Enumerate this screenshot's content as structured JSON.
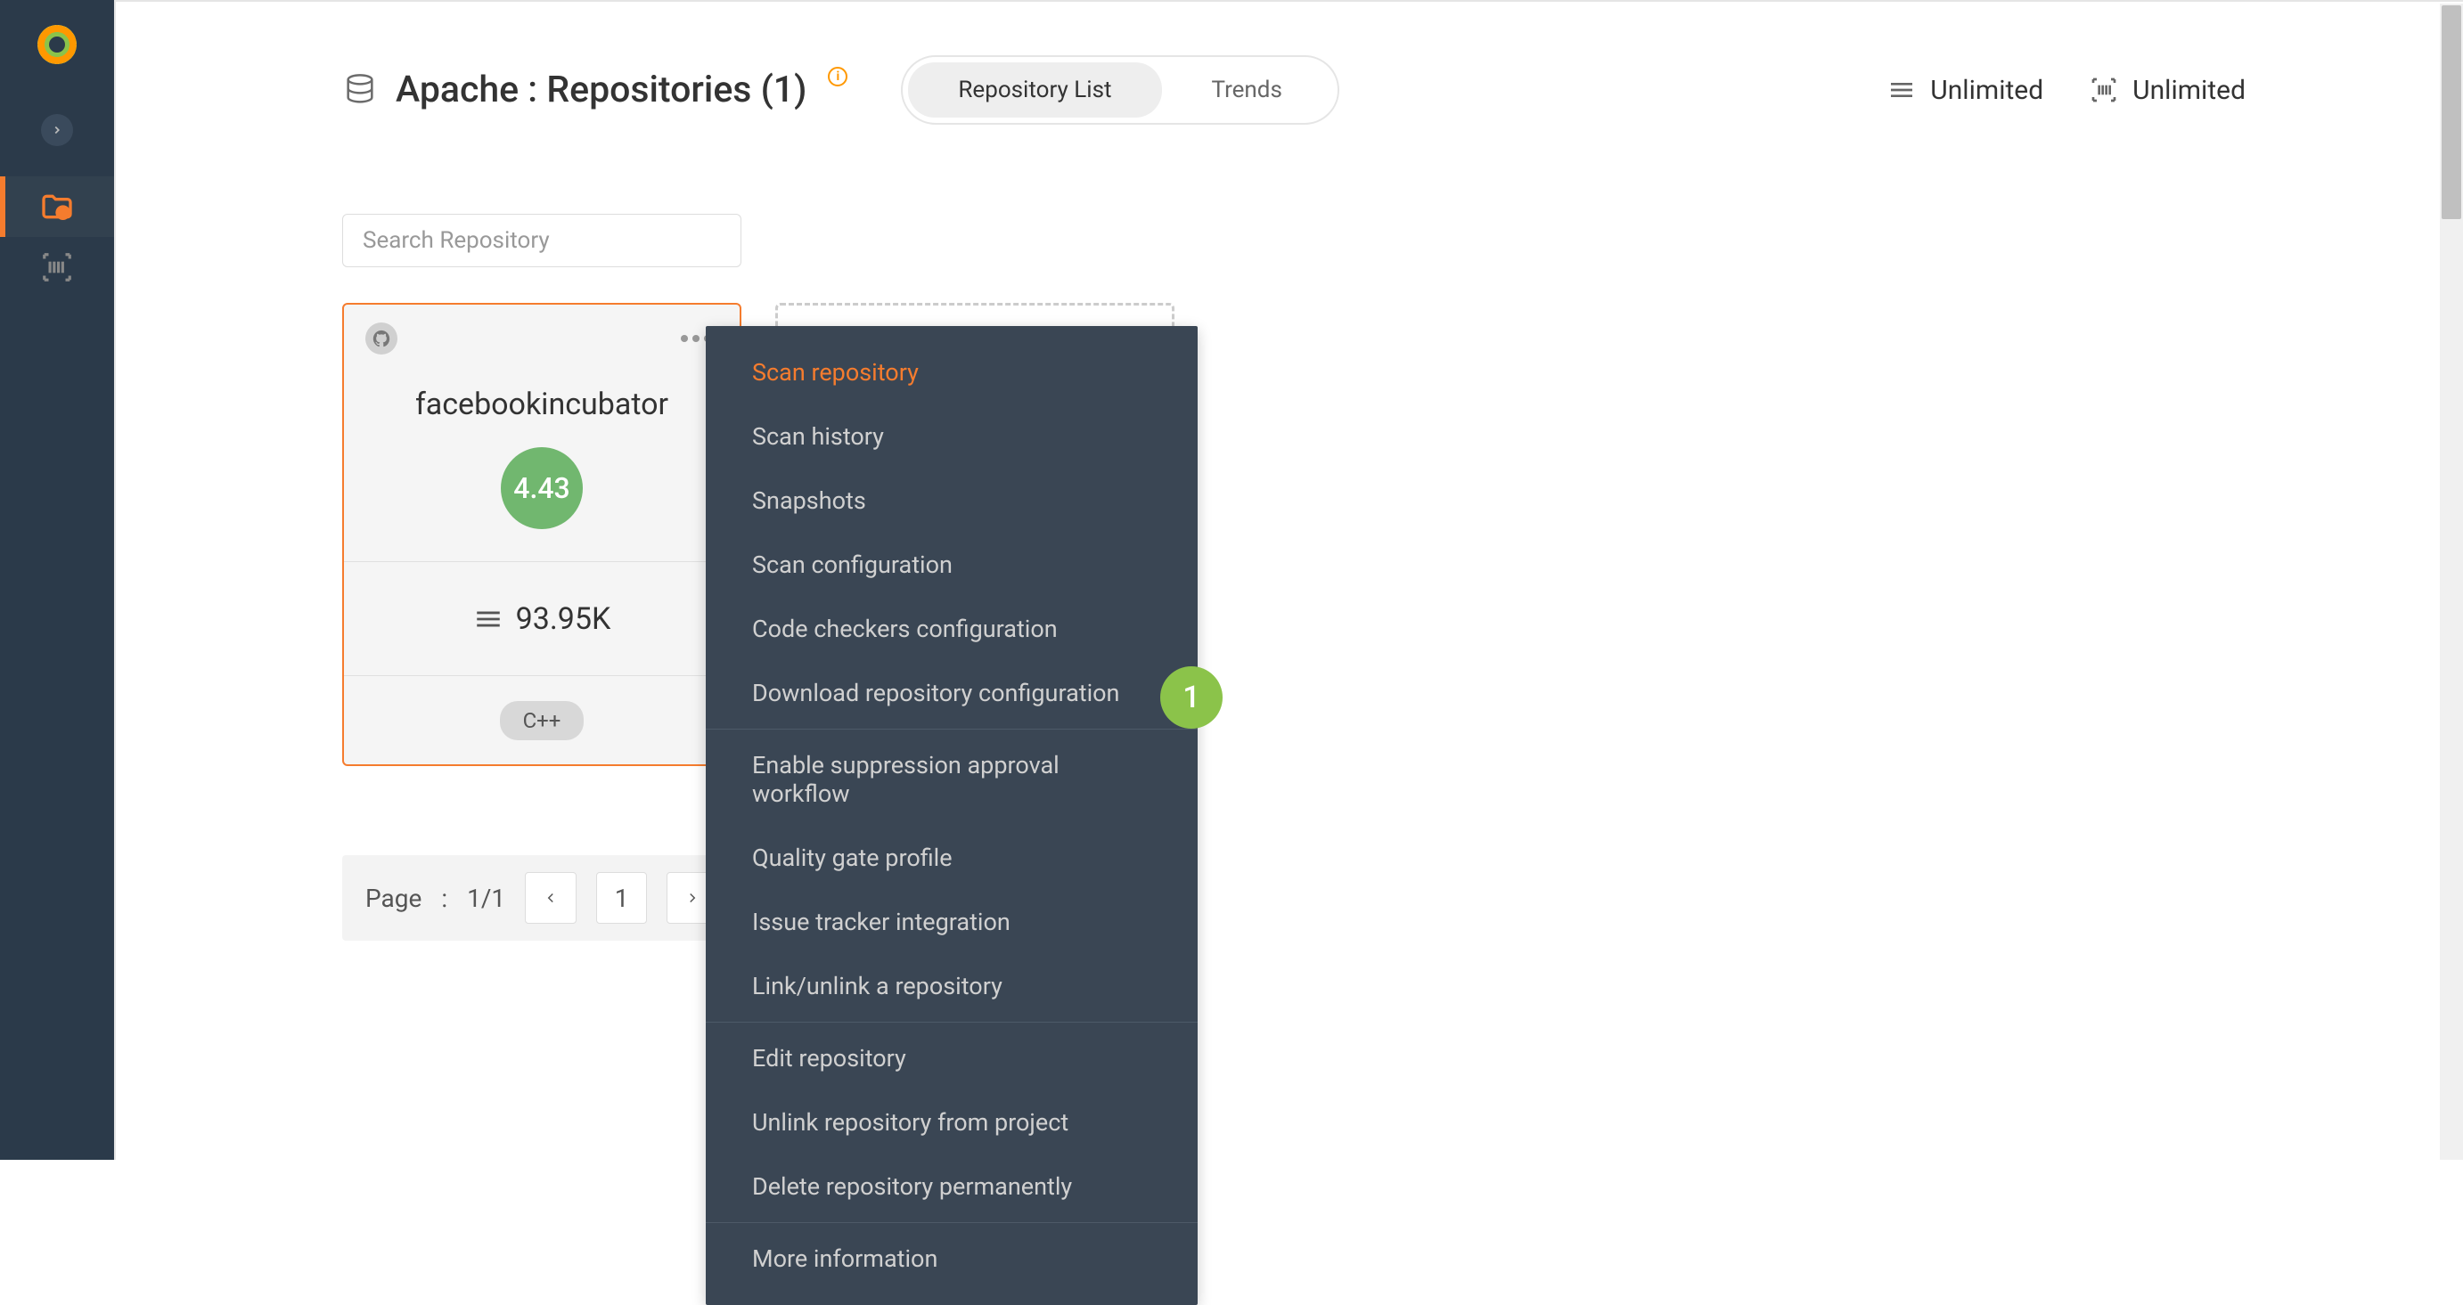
{
  "sidebar": {
    "items": [
      {
        "name": "expand",
        "icon": "chevron-right"
      },
      {
        "name": "projects",
        "icon": "folder-p",
        "active": true
      },
      {
        "name": "scans",
        "icon": "barcode"
      }
    ]
  },
  "header": {
    "title": "Apache : Repositories (1)",
    "tabs": [
      {
        "label": "Repository List",
        "active": true
      },
      {
        "label": "Trends",
        "active": false
      }
    ],
    "right": [
      {
        "icon": "lines",
        "label": "Unlimited"
      },
      {
        "icon": "barcode",
        "label": "Unlimited"
      }
    ]
  },
  "search": {
    "placeholder": "Search Repository"
  },
  "repo_card": {
    "name": "facebookincubator",
    "score": "4.43",
    "metric": "93.95K",
    "language": "C++"
  },
  "context_menu": {
    "groups": [
      [
        {
          "label": "Scan repository",
          "highlight": true
        },
        {
          "label": "Scan history"
        },
        {
          "label": "Snapshots"
        },
        {
          "label": "Scan configuration"
        },
        {
          "label": "Code checkers configuration"
        },
        {
          "label": "Download repository configuration"
        }
      ],
      [
        {
          "label": "Enable suppression approval workflow"
        },
        {
          "label": "Quality gate profile"
        },
        {
          "label": "Issue tracker integration"
        },
        {
          "label": "Link/unlink a repository"
        }
      ],
      [
        {
          "label": "Edit repository"
        },
        {
          "label": "Unlink repository from project"
        },
        {
          "label": "Delete repository permanently"
        }
      ],
      [
        {
          "label": "More information"
        }
      ]
    ]
  },
  "step_badge": "1",
  "pagination": {
    "page_label": "Page",
    "sep": ":",
    "range": "1/1",
    "current": "1"
  },
  "colors": {
    "accent": "#f57c2e",
    "sidebar_bg": "#2b3a4a",
    "menu_bg": "#3a4654",
    "score_green": "#71b76f",
    "badge_green": "#8bc34a"
  }
}
